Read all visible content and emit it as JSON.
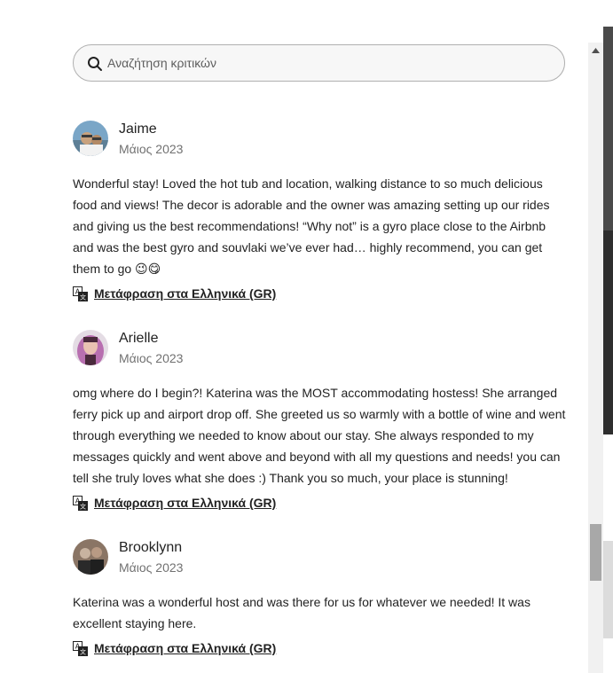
{
  "search": {
    "placeholder": "Αναζήτηση κριτικών",
    "icon": "search-icon"
  },
  "reviews": [
    {
      "name": "Jaime",
      "date": "Μάιος 2023",
      "text": "Wonderful stay! Loved the hot tub and location, walking distance to so much delicious food and views! The decor is adorable and the owner was amazing setting up our rides and giving us the best recommendations! “Why not” is a gyro place close to the Airbnb and was the best gyro and souvlaki we’ve ever had… highly recommend, you can get them to go 😉😋",
      "translate_label": "Μετάφραση στα Ελληνικά (GR)",
      "avatar_colors": [
        "#7aa6c7",
        "#c9a27e",
        "#3b3b3b"
      ]
    },
    {
      "name": "Arielle",
      "date": "Μάιος 2023",
      "text": "omg where do I begin?! Katerina was the MOST accommodating hostess! She arranged ferry pick up and airport drop off. She greeted us so warmly with a bottle of wine and went through everything we needed to know about our stay. She always responded to my messages quickly and went above and beyond with all my questions and needs! you can tell she truly loves what she does :) Thank you so much, your place is stunning!",
      "translate_label": "Μετάφραση στα Ελληνικά (GR)",
      "avatar_colors": [
        "#b86fb0",
        "#4a2a3c",
        "#e9c2b2"
      ]
    },
    {
      "name": "Brooklynn",
      "date": "Μάιος 2023",
      "text": "Katerina was a wonderful host and was there for us for whatever we needed! It was excellent staying here.",
      "translate_label": "Μετάφραση στα Ελληνικά (GR)",
      "avatar_colors": [
        "#8a7565",
        "#2a2a2a",
        "#c8b3a0"
      ]
    }
  ],
  "colors": {
    "text_primary": "#222222",
    "text_secondary": "#717171",
    "border": "#b0b0b0"
  }
}
